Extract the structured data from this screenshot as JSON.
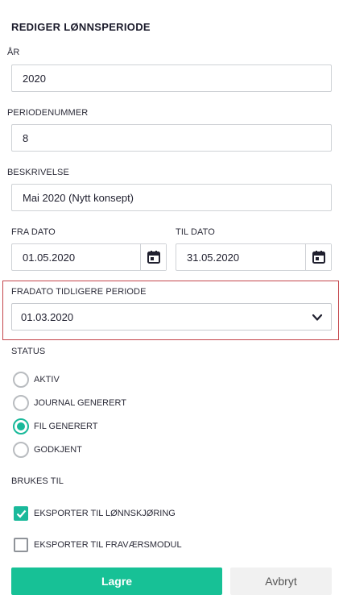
{
  "title": "REDIGER LØNNSPERIODE",
  "year": {
    "label": "ÅR",
    "value": "2020"
  },
  "period_number": {
    "label": "PERIODENUMMER",
    "value": "8"
  },
  "description": {
    "label": "BESKRIVELSE",
    "value": "Mai 2020 (Nytt konsept)"
  },
  "from_date": {
    "label": "FRA DATO",
    "value": "01.05.2020",
    "icon": "calendar-icon"
  },
  "to_date": {
    "label": "TIL DATO",
    "value": "31.05.2020",
    "icon": "calendar-icon"
  },
  "prev_from_date": {
    "label": "FRADATO TIDLIGERE PERIODE",
    "value": "01.03.2020",
    "icon": "chevron-down-icon"
  },
  "status": {
    "label": "STATUS",
    "options": [
      {
        "label": "AKTIV",
        "selected": false
      },
      {
        "label": "JOURNAL GENERERT",
        "selected": false
      },
      {
        "label": "FIL GENERERT",
        "selected": true
      },
      {
        "label": "GODKJENT",
        "selected": false
      }
    ]
  },
  "usage": {
    "label": "BRUKES TIL",
    "options": [
      {
        "label": "EKSPORTER TIL LØNNSKJØRING",
        "checked": true
      },
      {
        "label": "EKSPORTER TIL FRAVÆRSMODUL",
        "checked": false
      }
    ]
  },
  "buttons": {
    "save": "Lagre",
    "cancel": "Avbryt"
  },
  "colors": {
    "accent": "#17c196",
    "highlight_border": "#c4454b"
  }
}
